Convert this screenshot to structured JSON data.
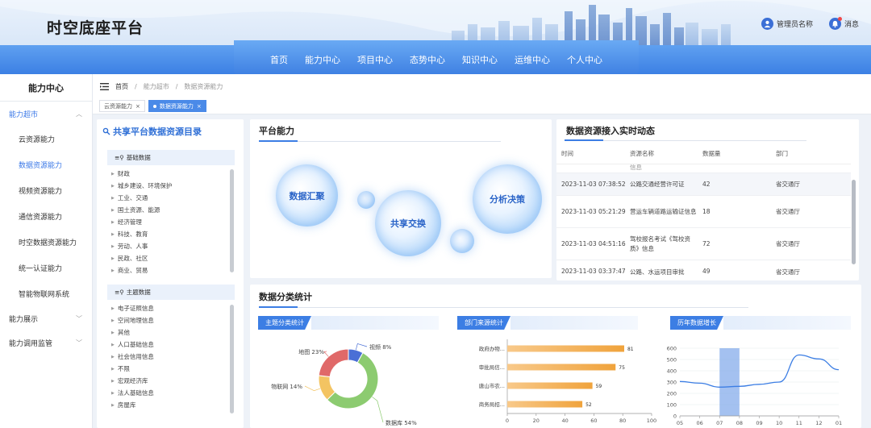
{
  "app": {
    "title": "时空底座平台"
  },
  "user": {
    "name": "管理员名称",
    "messages": "消息"
  },
  "nav": [
    "首页",
    "能力中心",
    "项目中心",
    "态势中心",
    "知识中心",
    "运维中心",
    "个人中心"
  ],
  "sidebar": {
    "title": "能力中心",
    "groups": [
      {
        "label": "能力超市",
        "items": [
          "云资源能力",
          "数据资源能力",
          "视频资源能力",
          "通信资源能力",
          "时空数据资源能力",
          "统一认证能力",
          "智能物联网系统"
        ]
      },
      {
        "label": "能力展示"
      },
      {
        "label": "能力调用监管"
      }
    ]
  },
  "breadcrumb": [
    "首页",
    "能力超市",
    "数据资源能力"
  ],
  "tabs": [
    "云资源能力",
    "数据资源能力"
  ],
  "catalog": {
    "title": "共享平台数据资源目录",
    "base": {
      "label": "基础数据",
      "items": [
        "财政",
        "城乡建设、环境保护",
        "工业、交通",
        "国土资源、能源",
        "经济管理",
        "科技、教育",
        "劳动、人事",
        "民政、社区",
        "商业、贸易"
      ]
    },
    "theme": {
      "label": "主题数据",
      "items": [
        "电子证照信息",
        "空间地理信息",
        "其他",
        "人口基础信息",
        "社会信用信息",
        "不限",
        "宏观经济库",
        "法人基础信息",
        "房屋库"
      ]
    }
  },
  "platform": {
    "title": "平台能力",
    "bubbles": [
      "数据汇聚",
      "共享交换",
      "分析决策"
    ]
  },
  "realtime": {
    "title": "数据资源接入实时动态",
    "columns": [
      "时间",
      "资源名称",
      "数据量",
      "部门"
    ],
    "partial": "信息",
    "rows": [
      {
        "time": "2023-11-03 07:38:52",
        "name": "公路交通经营许可证",
        "count": "42",
        "dept": "省交通厅"
      },
      {
        "time": "2023-11-03 05:21:29",
        "name": "营运车辆道路运输证信息",
        "count": "18",
        "dept": "省交通厅"
      },
      {
        "time": "2023-11-03 04:51:16",
        "name": "驾校报名考试《驾校资质》信息",
        "count": "72",
        "dept": "省交通厅"
      },
      {
        "time": "2023-11-03 03:37:47",
        "name": "公路、水运项目审批",
        "count": "49",
        "dept": "省交通厅"
      }
    ]
  },
  "stats": {
    "title": "数据分类统计",
    "subtitles": [
      "主题分类统计",
      "部门来源统计",
      "历年数据增长"
    ]
  },
  "chart_data": [
    {
      "type": "pie",
      "title": "主题分类统计",
      "labels": [
        "视频",
        "数据库",
        "物联网",
        "地图"
      ],
      "values": [
        8,
        54,
        14,
        23
      ],
      "display": [
        "视频 8%",
        "数据库 54%",
        "物联网 14%",
        "地图 23%"
      ],
      "colors": [
        "#4a6fd6",
        "#8ccb70",
        "#f3c462",
        "#e06969"
      ]
    },
    {
      "type": "bar",
      "title": "部门来源统计",
      "orientation": "horizontal",
      "categories": [
        "政府办物...",
        "审批局信...",
        "唐山市农...",
        "商务局招..."
      ],
      "values": [
        81,
        75,
        59,
        52
      ],
      "xlim": [
        0,
        100
      ],
      "xticks": [
        0,
        20,
        40,
        60,
        80,
        100
      ],
      "color": "#f0a33c"
    },
    {
      "type": "line",
      "title": "历年数据增长",
      "x": [
        "05",
        "06",
        "07",
        "08",
        "09",
        "10",
        "11",
        "12",
        "01"
      ],
      "values": [
        305,
        290,
        255,
        262,
        280,
        300,
        540,
        505,
        410
      ],
      "ylim": [
        0,
        600
      ],
      "yticks": [
        0,
        100,
        200,
        300,
        400,
        500,
        600
      ],
      "highlight": "07",
      "color": "#3c7ee4"
    }
  ]
}
